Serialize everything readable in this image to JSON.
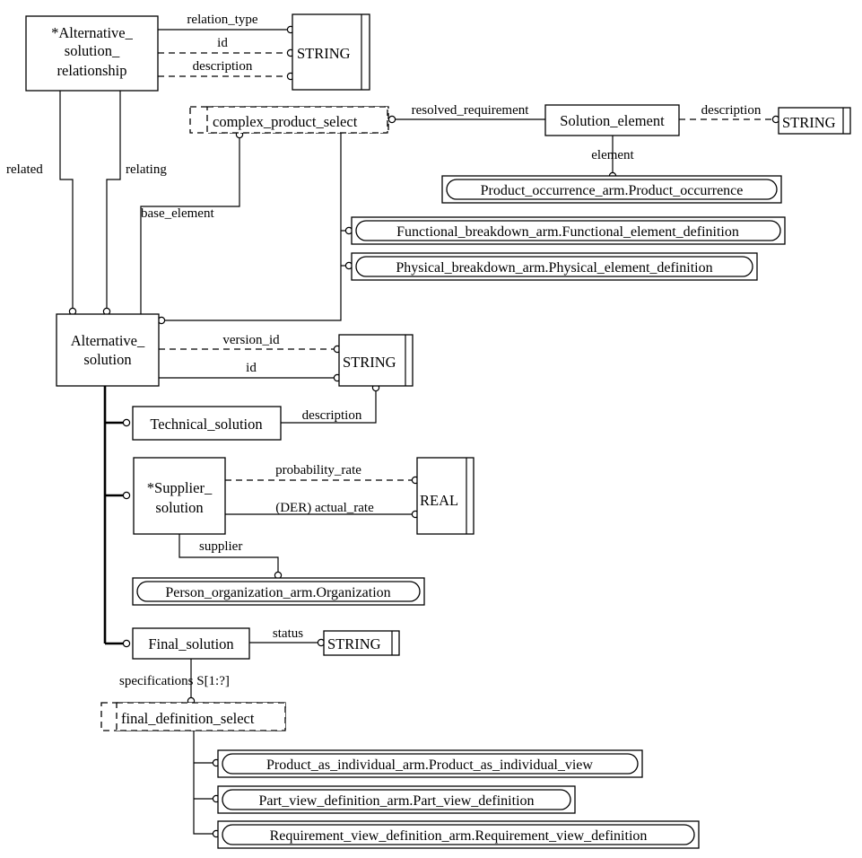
{
  "diagram": {
    "title": "Alternative solution EXPRESS-G diagram",
    "notation": "EXPRESS-G",
    "line_color": "#000000",
    "background_color": "#ffffff"
  },
  "entities": {
    "alternative_solution_relationship": "*Alternative_\nsolution_\nrelationship",
    "alternative_solution_relationship_l1": "*Alternative_",
    "alternative_solution_relationship_l2": "solution_",
    "alternative_solution_relationship_l3": "relationship",
    "alternative_solution_l1": "Alternative_",
    "alternative_solution_l2": "solution",
    "solution_element": "Solution_element",
    "technical_solution": "Technical_solution",
    "supplier_solution_l1": "*Supplier_",
    "supplier_solution_l2": "solution",
    "final_solution": "Final_solution"
  },
  "selects": {
    "complex_product_select": "complex_product_select",
    "final_definition_select": "final_definition_select"
  },
  "primitives": {
    "string_top": "STRING",
    "string_right": "STRING",
    "string_mid": "STRING",
    "string_bottom": "STRING",
    "real": "REAL"
  },
  "external_refs": {
    "product_occurrence": "Product_occurrence_arm.Product_occurrence",
    "functional_element_definition": "Functional_breakdown_arm.Functional_element_definition",
    "physical_element_definition": "Physical_breakdown_arm.Physical_element_definition",
    "organization": "Person_organization_arm.Organization",
    "product_as_individual_view": "Product_as_individual_arm.Product_as_individual_view",
    "part_view_definition": "Part_view_definition_arm.Part_view_definition",
    "requirement_view_definition": "Requirement_view_definition_arm.Requirement_view_definition"
  },
  "attributes": {
    "relation_type": "relation_type",
    "id_top": "id",
    "description_top": "description",
    "resolved_requirement": "resolved_requirement",
    "description_solution_element": "description",
    "element": "element",
    "related": "related",
    "relating": "relating",
    "base_element": "base_element",
    "version_id": "version_id",
    "id_alt": "id",
    "description_tech": "description",
    "probability_rate": "probability_rate",
    "actual_rate": "(DER) actual_rate",
    "supplier": "supplier",
    "status": "status",
    "specifications": "specifications S[1:?]"
  }
}
